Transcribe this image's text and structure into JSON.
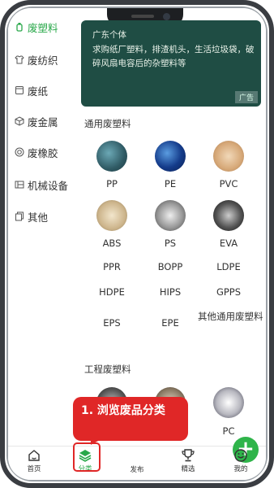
{
  "sidebar": {
    "items": [
      {
        "label": "废塑料",
        "icon": "bottle-icon",
        "active": true
      },
      {
        "label": "废纺织",
        "icon": "shirt-icon",
        "active": false
      },
      {
        "label": "废纸",
        "icon": "paper-icon",
        "active": false
      },
      {
        "label": "废金属",
        "icon": "cube-icon",
        "active": false
      },
      {
        "label": "废橡胶",
        "icon": "tire-icon",
        "active": false
      },
      {
        "label": "机械设备",
        "icon": "machine-icon",
        "active": false
      },
      {
        "label": "其他",
        "icon": "copy-icon",
        "active": false
      }
    ]
  },
  "banner": {
    "title": "广东个体",
    "text": "求购纸厂塑料，排渣机头，生活垃圾袋，破碎风扇电容后的杂塑料等",
    "ad_tag": "广告"
  },
  "sections": {
    "general": {
      "title": "通用废塑料",
      "row1": [
        "PP",
        "PE",
        "PVC"
      ],
      "row2": [
        "ABS",
        "PS",
        "EVA"
      ],
      "row3": [
        "PPR",
        "BOPP",
        "LDPE"
      ],
      "row4": [
        "HDPE",
        "HIPS",
        "GPPS"
      ],
      "row5": [
        "EPS",
        "EPE",
        "其他通用废塑料"
      ]
    },
    "engineering": {
      "title": "工程废塑料",
      "row1": [
        "PC"
      ]
    }
  },
  "tabbar": {
    "items": [
      {
        "label": "首页",
        "icon": "home-icon"
      },
      {
        "label": "分类",
        "icon": "layers-icon"
      },
      {
        "label": "发布",
        "icon": "plus-icon"
      },
      {
        "label": "精选",
        "icon": "trophy-icon"
      },
      {
        "label": "我的",
        "icon": "user-icon"
      }
    ]
  },
  "annotation": {
    "callout_text": "1. 浏览废品分类"
  },
  "colors": {
    "accent_green": "#29a84a",
    "callout_red": "#e02727",
    "banner_bg": "#1f4d44"
  }
}
